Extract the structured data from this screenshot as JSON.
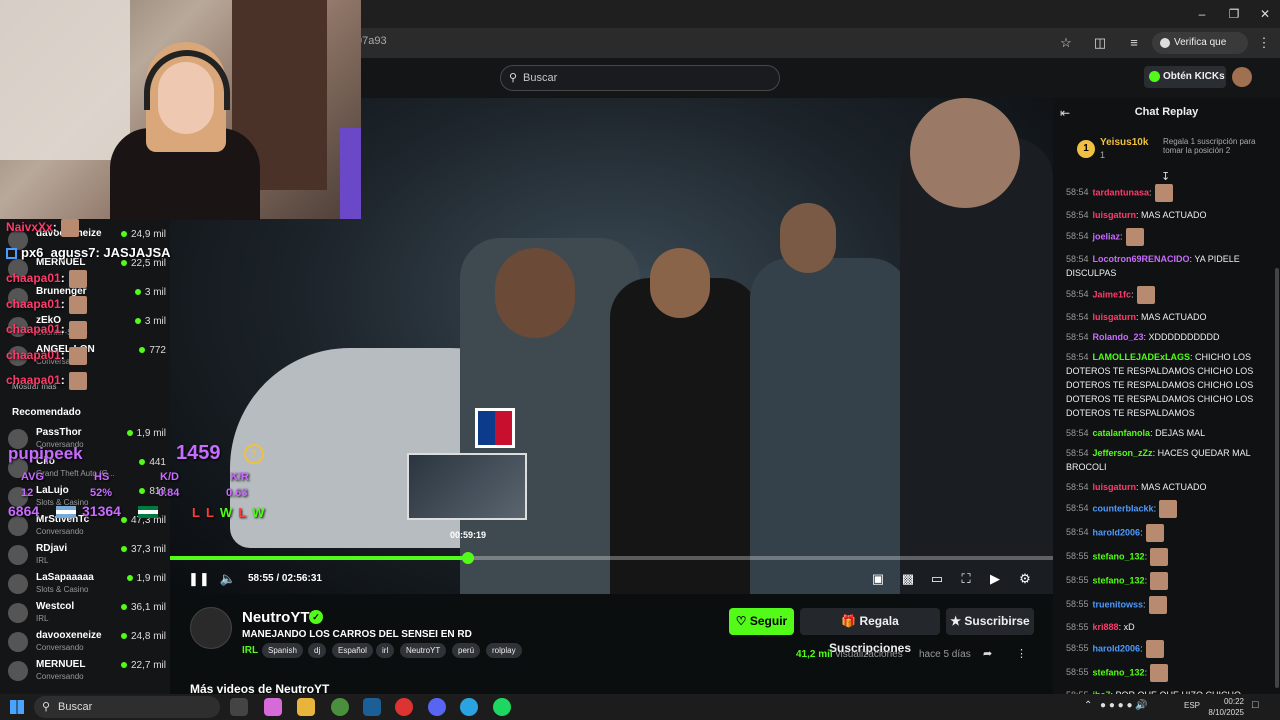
{
  "browser": {
    "url": "97a93",
    "verify_label": "Verifica que eres tú"
  },
  "header": {
    "search_placeholder": "Buscar",
    "kicks_label": "Obtén KICKs"
  },
  "sidebar": {
    "following": [
      {
        "name": "davooxeneize",
        "sub": "",
        "count": "24,9 mil"
      },
      {
        "name": "MERNUEL",
        "sub": "",
        "count": "22,5 mil"
      },
      {
        "name": "Brunenger",
        "sub": "",
        "count": "3 mil"
      },
      {
        "name": "zEkO",
        "sub": "Counter-Strike",
        "count": "3 mil"
      },
      {
        "name": "ANGEL LON",
        "sub": "Conversando",
        "count": "772"
      }
    ],
    "show_more": "Mostrar más",
    "recommended_title": "Recomendado",
    "recommended": [
      {
        "name": "PassThor",
        "sub": "Conversando",
        "count": "1,9 mil"
      },
      {
        "name": "Cilo",
        "sub": "Grand Theft Auto (G...",
        "count": "441"
      },
      {
        "name": "LaLujo",
        "sub": "Slots & Casino",
        "count": "818"
      },
      {
        "name": "MrStivenTc",
        "sub": "Conversando",
        "count": "47,3 mil"
      },
      {
        "name": "RDjavi",
        "sub": "IRL",
        "count": "37,3 mil"
      },
      {
        "name": "LaSapaaaaa",
        "sub": "Slots & Casino",
        "count": "1,9 mil"
      },
      {
        "name": "Westcol",
        "sub": "IRL",
        "count": "36,1 mil"
      },
      {
        "name": "davooxeneize",
        "sub": "Conversando",
        "count": "24,8 mil"
      },
      {
        "name": "MERNUEL",
        "sub": "Conversando",
        "count": "22,7 mil"
      }
    ]
  },
  "overlay": {
    "chat": [
      {
        "user": "NaivxXx",
        "text": ":",
        "color": "#ff3b6b"
      },
      {
        "user": "px6_aguss7",
        "text": ": JASJAJSA",
        "color": "#ffffff"
      },
      {
        "user": "chaapa01",
        "text": ":",
        "color": "#ff3b6b"
      },
      {
        "user": "chaapa01",
        "text": ":",
        "color": "#ff3b6b"
      },
      {
        "user": "chaapa01",
        "text": ":",
        "color": "#ff3b6b"
      },
      {
        "user": "chaapa01",
        "text": ":",
        "color": "#ff3b6b"
      },
      {
        "user": "chaapa01",
        "text": ":",
        "color": "#ff3b6b"
      }
    ],
    "stats": {
      "player": "pupipeek",
      "rating": "1459",
      "level": "7",
      "avg_label": "AVG",
      "avg": "12",
      "hs_label": "HS",
      "hs": "52%",
      "kd_label": "K/D",
      "kd": "0.84",
      "kr_label": "K/R",
      "kr": "0.63",
      "elo_a": "6864",
      "elo_b": "31364",
      "results": [
        "L",
        "L",
        "W",
        "L",
        "W"
      ]
    }
  },
  "player": {
    "hover_time": "00:59:19",
    "current_time": "58:55",
    "separator": "/",
    "duration": "02:56:31",
    "progress_fraction": 0.337
  },
  "channel": {
    "name": "NeutroYT",
    "title": "MANEJANDO LOS CARROS DEL SENSEI EN RD",
    "category": "IRL",
    "tags": [
      "Spanish",
      "dj",
      "Español",
      "irl",
      "NeutroYT",
      "perú",
      "rolplay"
    ],
    "follow_label": "Seguir",
    "gift_label": "Regala Suscripciones",
    "subscribe_label": "Suscribirse",
    "views_count": "41,2 mil",
    "views_label": "visualizaciones",
    "ago": "hace 5 días",
    "more_videos": "Más videos de NeutroYT"
  },
  "chat": {
    "title": "Chat Replay",
    "top_rank": "1",
    "top_user": "Yeisus10k",
    "top_count": "1",
    "gift_promo": "Regala 1 suscripción para tomar la posición 2",
    "messages": [
      {
        "ts": "58:54",
        "user": "tardantunasa",
        "text": ":",
        "color": "#ff3b6b"
      },
      {
        "ts": "58:54",
        "user": "luisgaturn",
        "text": ": MAS ACTUADO",
        "color": "#ff3b6b"
      },
      {
        "ts": "58:54",
        "user": "joeliaz",
        "text": ":",
        "color": "#c86bff"
      },
      {
        "ts": "58:54",
        "user": "Locotron69RENACIDO",
        "text": ": YA PIDELE DISCULPAS",
        "color": "#c86bff"
      },
      {
        "ts": "58:54",
        "user": "Jaime1fc",
        "text": ":",
        "color": "#ff3b6b"
      },
      {
        "ts": "58:54",
        "user": "luisgaturn",
        "text": ": MAS ACTUADO",
        "color": "#ff3b6b"
      },
      {
        "ts": "58:54",
        "user": "Rolando_23",
        "text": ": XDDDDDDDDDD",
        "color": "#c86bff"
      },
      {
        "ts": "58:54",
        "user": "LAMOLLEJADExLAGS",
        "text": ": CHICHO LOS DOTEROS TE RESPALDAMOS  CHICHO LOS DOTEROS TE RESPALDAMOS  CHICHO LOS DOTEROS TE RESPALDAMOS  CHICHO LOS DOTEROS TE RESPALDAMOS",
        "color": "#53fc18"
      },
      {
        "ts": "58:54",
        "user": "catalanfanola",
        "text": ": DEJAS MAL",
        "color": "#53fc18"
      },
      {
        "ts": "58:54",
        "user": "Jefferson_zZz",
        "text": ": HACES QUEDAR MAL BROCOLI",
        "color": "#53fc18"
      },
      {
        "ts": "58:54",
        "user": "luisgaturn",
        "text": ": MAS ACTUADO",
        "color": "#ff3b6b"
      },
      {
        "ts": "58:54",
        "user": "counterblackk",
        "text": ":",
        "color": "#4d9bff"
      },
      {
        "ts": "58:54",
        "user": "harold2006",
        "text": ":",
        "color": "#4d9bff"
      },
      {
        "ts": "58:55",
        "user": "stefano_132",
        "text": ":",
        "color": "#53fc18"
      },
      {
        "ts": "58:55",
        "user": "stefano_132",
        "text": ":",
        "color": "#53fc18"
      },
      {
        "ts": "58:55",
        "user": "truenitowss",
        "text": ":",
        "color": "#4d9bff"
      },
      {
        "ts": "58:55",
        "user": "kri888",
        "text": ": xD",
        "color": "#ff3b6b"
      },
      {
        "ts": "58:55",
        "user": "harold2006",
        "text": ":",
        "color": "#4d9bff"
      },
      {
        "ts": "58:55",
        "user": "stefano_132",
        "text": ":",
        "color": "#53fc18"
      },
      {
        "ts": "58:55",
        "user": "jbe7",
        "text": ": POR QUE QUE HIZO CHICHO",
        "color": "#53fc18"
      }
    ]
  },
  "taskbar": {
    "search_label": "Buscar",
    "lang": "ESP",
    "time": "00:22",
    "date": "8/10/2025"
  },
  "colors": {
    "accent": "#53fc18",
    "background": "#0b0e0f"
  }
}
